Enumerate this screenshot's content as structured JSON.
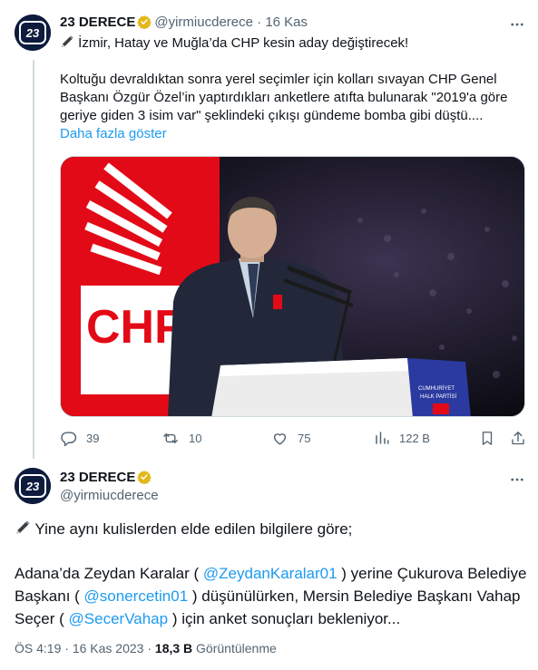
{
  "colors": {
    "accent": "#1d9bf0",
    "text": "#0f1419",
    "muted": "#536471",
    "verified": "#e2b719",
    "chp_red": "#e30a17"
  },
  "tweet1": {
    "display_name": "23 DERECE",
    "handle": "@yirmiucderece",
    "separator": "·",
    "time": "16 Kas",
    "line1_icon": "pen-icon",
    "line1": "İzmir, Hatay ve Muğla’da CHP kesin aday değiştirecek!",
    "body_lines": [
      "Koltuğu devraldıktan sonra yerel seçimler için kolları sıvayan CHP Genel",
      "Başkanı Özgür Özel’in yaptırdıkları anketlere atıfta bulunarak \"2019'a göre",
      "geriye giden 3 isim var\" şeklindeki çıkışı gündeme bomba gibi düştü...."
    ],
    "show_more": "Daha fazla göster",
    "image": {
      "banner_text": "CHP",
      "podium_text_1": "CUMHURİYET",
      "podium_text_2": "HALK PARTİSİ"
    },
    "actions": {
      "replies": "39",
      "retweets": "10",
      "likes": "75",
      "views": "122 B"
    }
  },
  "tweet2": {
    "display_name": "23 DERECE",
    "handle": "@yirmiucderece",
    "line1": "Yine aynı kulislerden elde edilen bilgilere göre;",
    "body": {
      "r1a": "Adana’da Zeydan Karalar ( ",
      "m1": "@ZeydanKaralar01",
      "r1b": " ) yerine Çukurova Belediye",
      "r2a": "Başkanı ( ",
      "m2": "@sonercetin01",
      "r2b": " ) düşünülürken, Mersin Belediye Başkanı Vahap",
      "r3a": "Seçer ( ",
      "m3": "@SecerVahap",
      "r3b": " ) için anket sonuçları bekleniyor..."
    },
    "meta": {
      "time": "ÖS 4:19",
      "dot": "·",
      "date": "16 Kas 2023",
      "dot2": "·",
      "views": "18,3 B",
      "views_label": "Görüntülenme"
    }
  }
}
